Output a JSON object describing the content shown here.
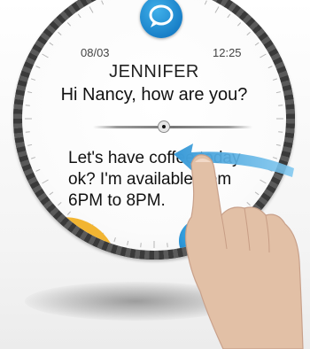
{
  "message": {
    "date": "08/03",
    "time": "12:25",
    "sender": "JENNIFER",
    "line1": "Hi Nancy, how are you?",
    "body_lines": [
      "Let's have coffee today",
      "ok? I'm available from",
      "6PM to 8PM."
    ]
  },
  "icons": {
    "top": "chat-bubble-icon",
    "reply": "pencil-icon",
    "emoji": "smiley-icon",
    "gesture": "swipe-left-arrow",
    "hand": "hand-pointer"
  },
  "colors": {
    "accent_blue": "#1a8fd8",
    "reply_yellow": "#f2b532",
    "arrow_blue": "#56aee0",
    "bezel": "#333333"
  }
}
